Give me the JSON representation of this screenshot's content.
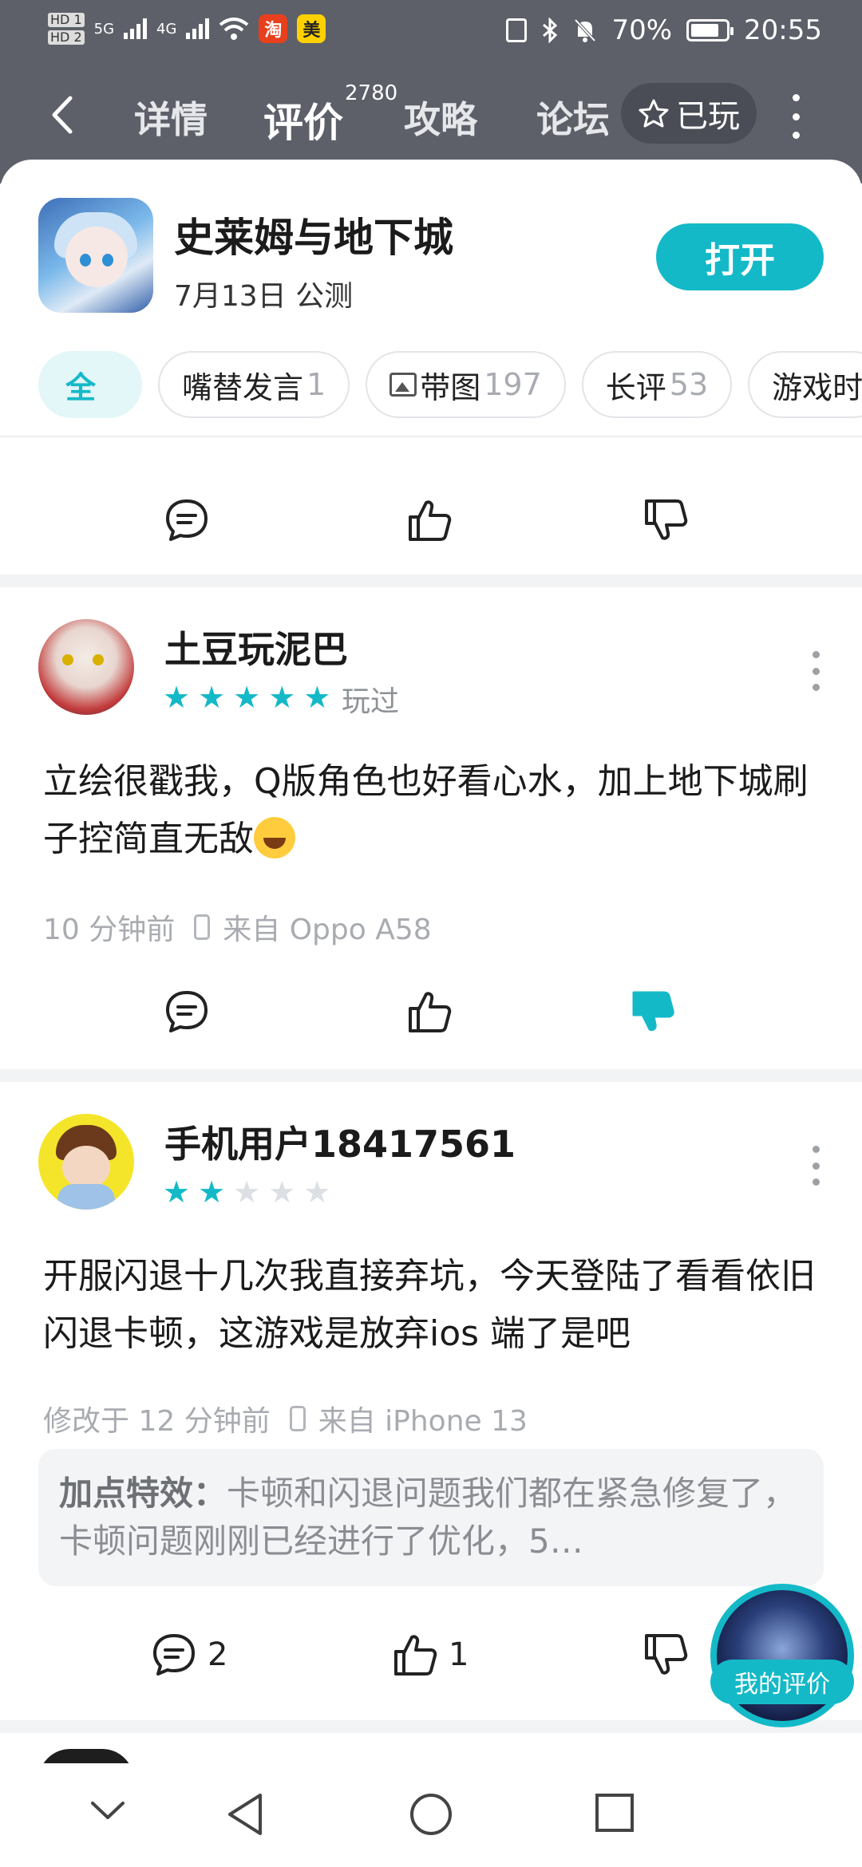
{
  "status_bar": {
    "network_left": "5G",
    "network_right": "4G",
    "taobao_icon": "淘",
    "meituan_icon": "美",
    "battery": "70%",
    "time": "20:55"
  },
  "nav": {
    "tabs": [
      {
        "label": "详情"
      },
      {
        "label": "评价"
      },
      {
        "label": "攻略"
      },
      {
        "label": "论坛"
      }
    ],
    "review_count": "2780",
    "played_label": "已玩"
  },
  "game": {
    "title": "史莱姆与地下城",
    "subtitle": "7月13日 公测",
    "open_label": "打开"
  },
  "filters": [
    {
      "label": "全",
      "count": ""
    },
    {
      "label": "嘴替发言",
      "count": "1"
    },
    {
      "label": "带图",
      "count": "197"
    },
    {
      "label": "长评",
      "count": "53"
    },
    {
      "label": "游戏时",
      "count": ""
    }
  ],
  "reviews": [
    {
      "user": "土豆玩泥巴",
      "rating": 5,
      "tag": "玩过",
      "text": "立绘很戳我，Q版角色也好看心水，加上地下城刷子控简直无敌",
      "time": "10 分钟前",
      "device": "来自 Oppo A58",
      "comments": "",
      "likes": ""
    },
    {
      "user": "手机用户18417561",
      "rating": 2,
      "tag": "",
      "text": "开服闪退十几次我直接弃坑，今天登陆了看看依旧闪退卡顿，这游戏是放弃ios 端了是吧",
      "time": "修改于 12 分钟前",
      "device": "来自 iPhone 13",
      "reply_author": "加点特效：",
      "reply_text": "卡顿和闪退问题我们都在紧急修复了，卡顿问题刚刚已经进行了优化，5…",
      "comments": "2",
      "likes": "1"
    }
  ],
  "fab_label": "我的评价",
  "colors": {
    "accent": "#14b9c8",
    "header_bg": "#5d6069",
    "page_bg": "#f2f3f5"
  }
}
